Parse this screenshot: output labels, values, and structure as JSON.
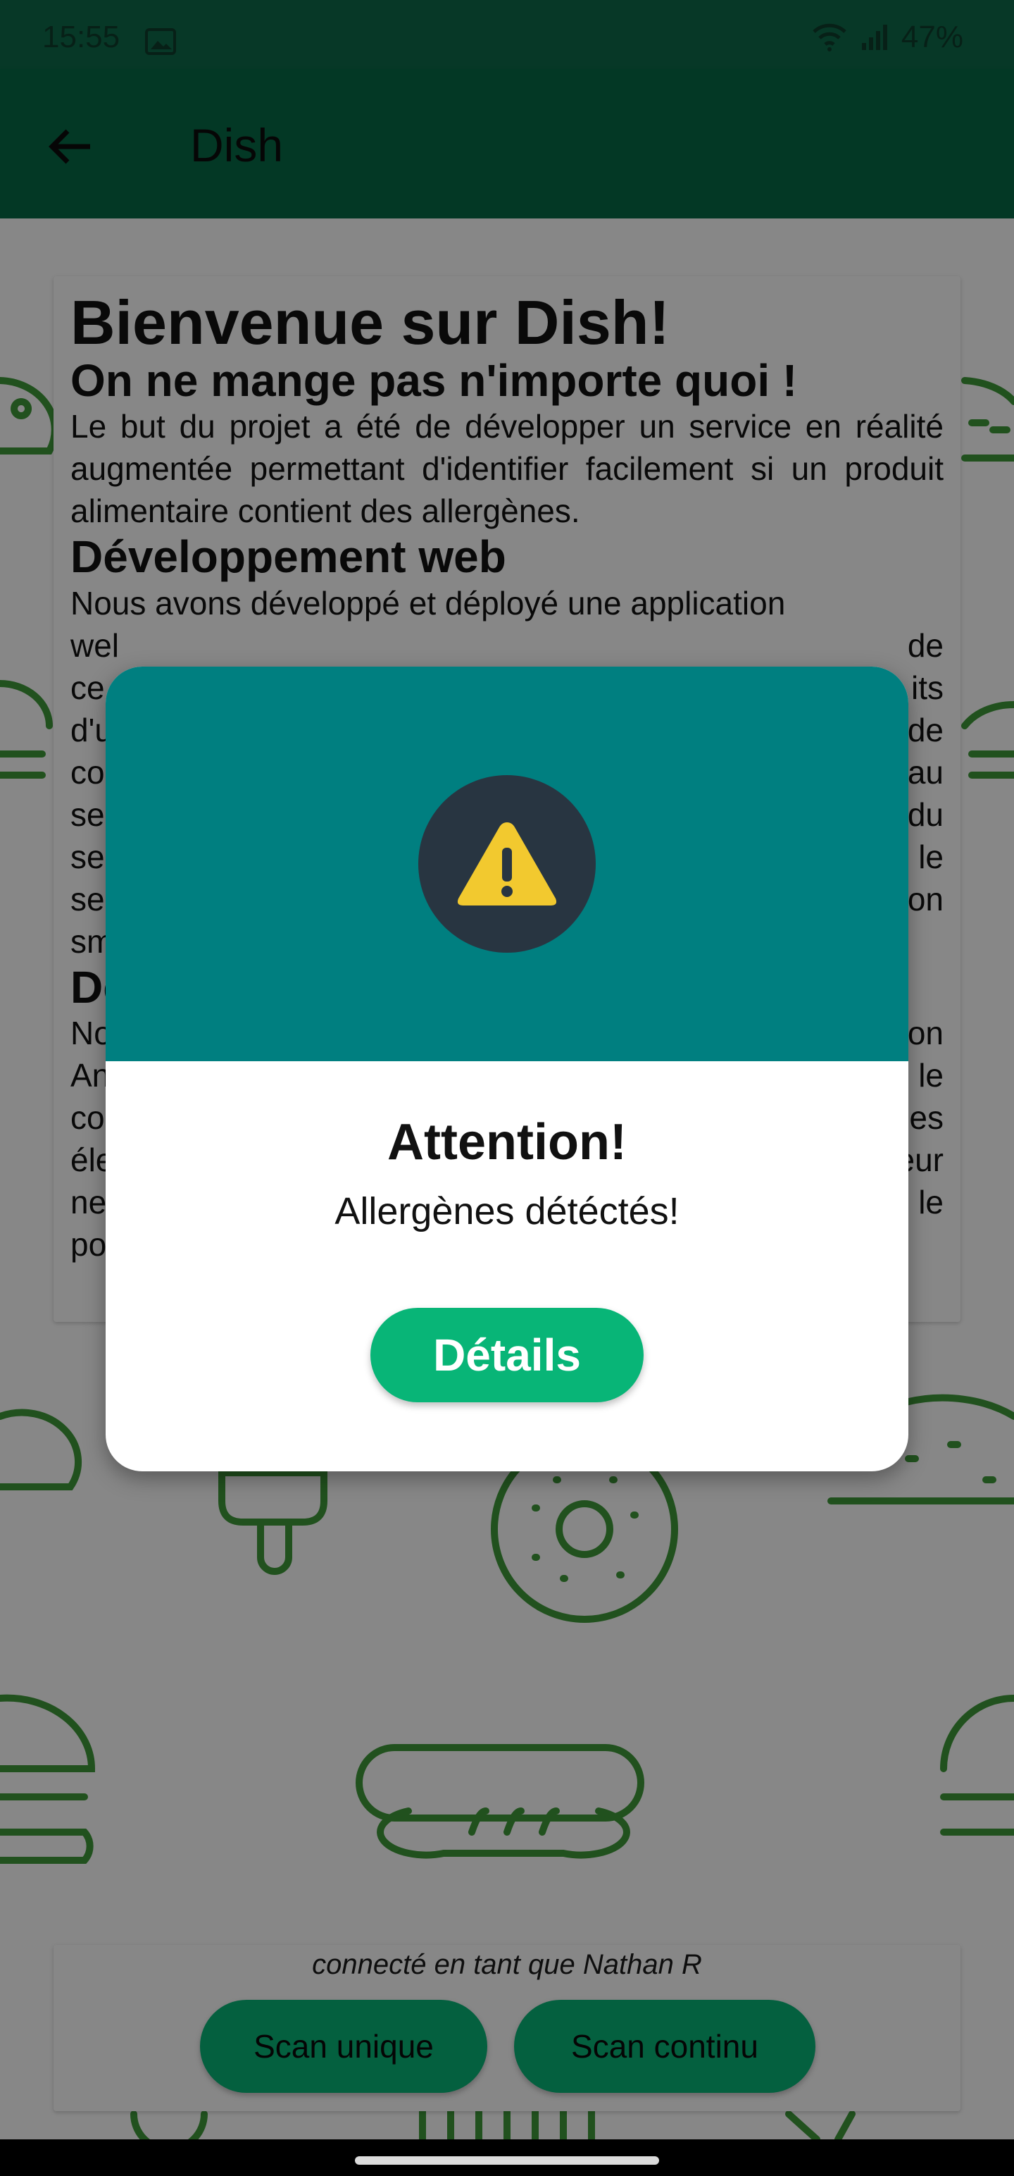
{
  "status_bar": {
    "time": "15:55",
    "battery": "47%",
    "image_icon": "image-icon",
    "wifi_icon": "wifi-icon",
    "signal_icon": "signal-icon"
  },
  "app_bar": {
    "title": "Dish",
    "back_icon": "arrow-left-icon"
  },
  "info_card": {
    "heading": "Bienvenue sur Dish!",
    "section1_title": "On ne mange pas n'importe quoi !",
    "section1_text": "Le but du projet a été de développer un service en réalité augmentée permettant d'identifier facilement si un produit alimentaire contient des allergènes.",
    "section2_title": "Développement web",
    "section2_text_visible": "Nous avons développé et déployé une application",
    "section2_line2_start": "wel",
    "section2_line2_end": "de",
    "section2_line3_start": "ce",
    "section2_line3_end": "its",
    "section2_line4_start": "d'u",
    "section2_line4_end": "de",
    "section2_line5_start": "co",
    "section2_line5_end": "au",
    "section2_line6_start": "se",
    "section2_line6_end": "du",
    "section2_line7_start": "se",
    "section2_line7_end": "le",
    "section2_line8_start": "se",
    "section2_line8_end": "on",
    "section2_line9_start": "sm",
    "section3_title_start": "De",
    "section3_line1_start": "No",
    "section3_line1_end": "on",
    "section3_line2_start": "An",
    "section3_line2_end": "le",
    "section3_line3_start": "co",
    "section3_line3_end": "es",
    "section3_line4_start": "éle",
    "section3_line4_end": "eur",
    "section3_line5_start": "ne",
    "section3_line5_end": "le",
    "section3_line6_start": "po"
  },
  "bottom_panel": {
    "connected_as": "connecté en tant que Nathan R",
    "scan_single_label": "Scan unique",
    "scan_continuous_label": "Scan continu"
  },
  "dialog": {
    "icon": "warning-icon",
    "title": "Attention!",
    "subtitle": "Allergènes détéctés!",
    "details_label": "Détails"
  },
  "colors": {
    "app_bar": "#066a46",
    "status_bar": "#0e6b4a",
    "dialog_header": "#007f80",
    "warning_circle": "#283541",
    "warning_triangle": "#f2c92f",
    "button_green": "#08b577",
    "pattern_green": "#3f9a3a"
  }
}
